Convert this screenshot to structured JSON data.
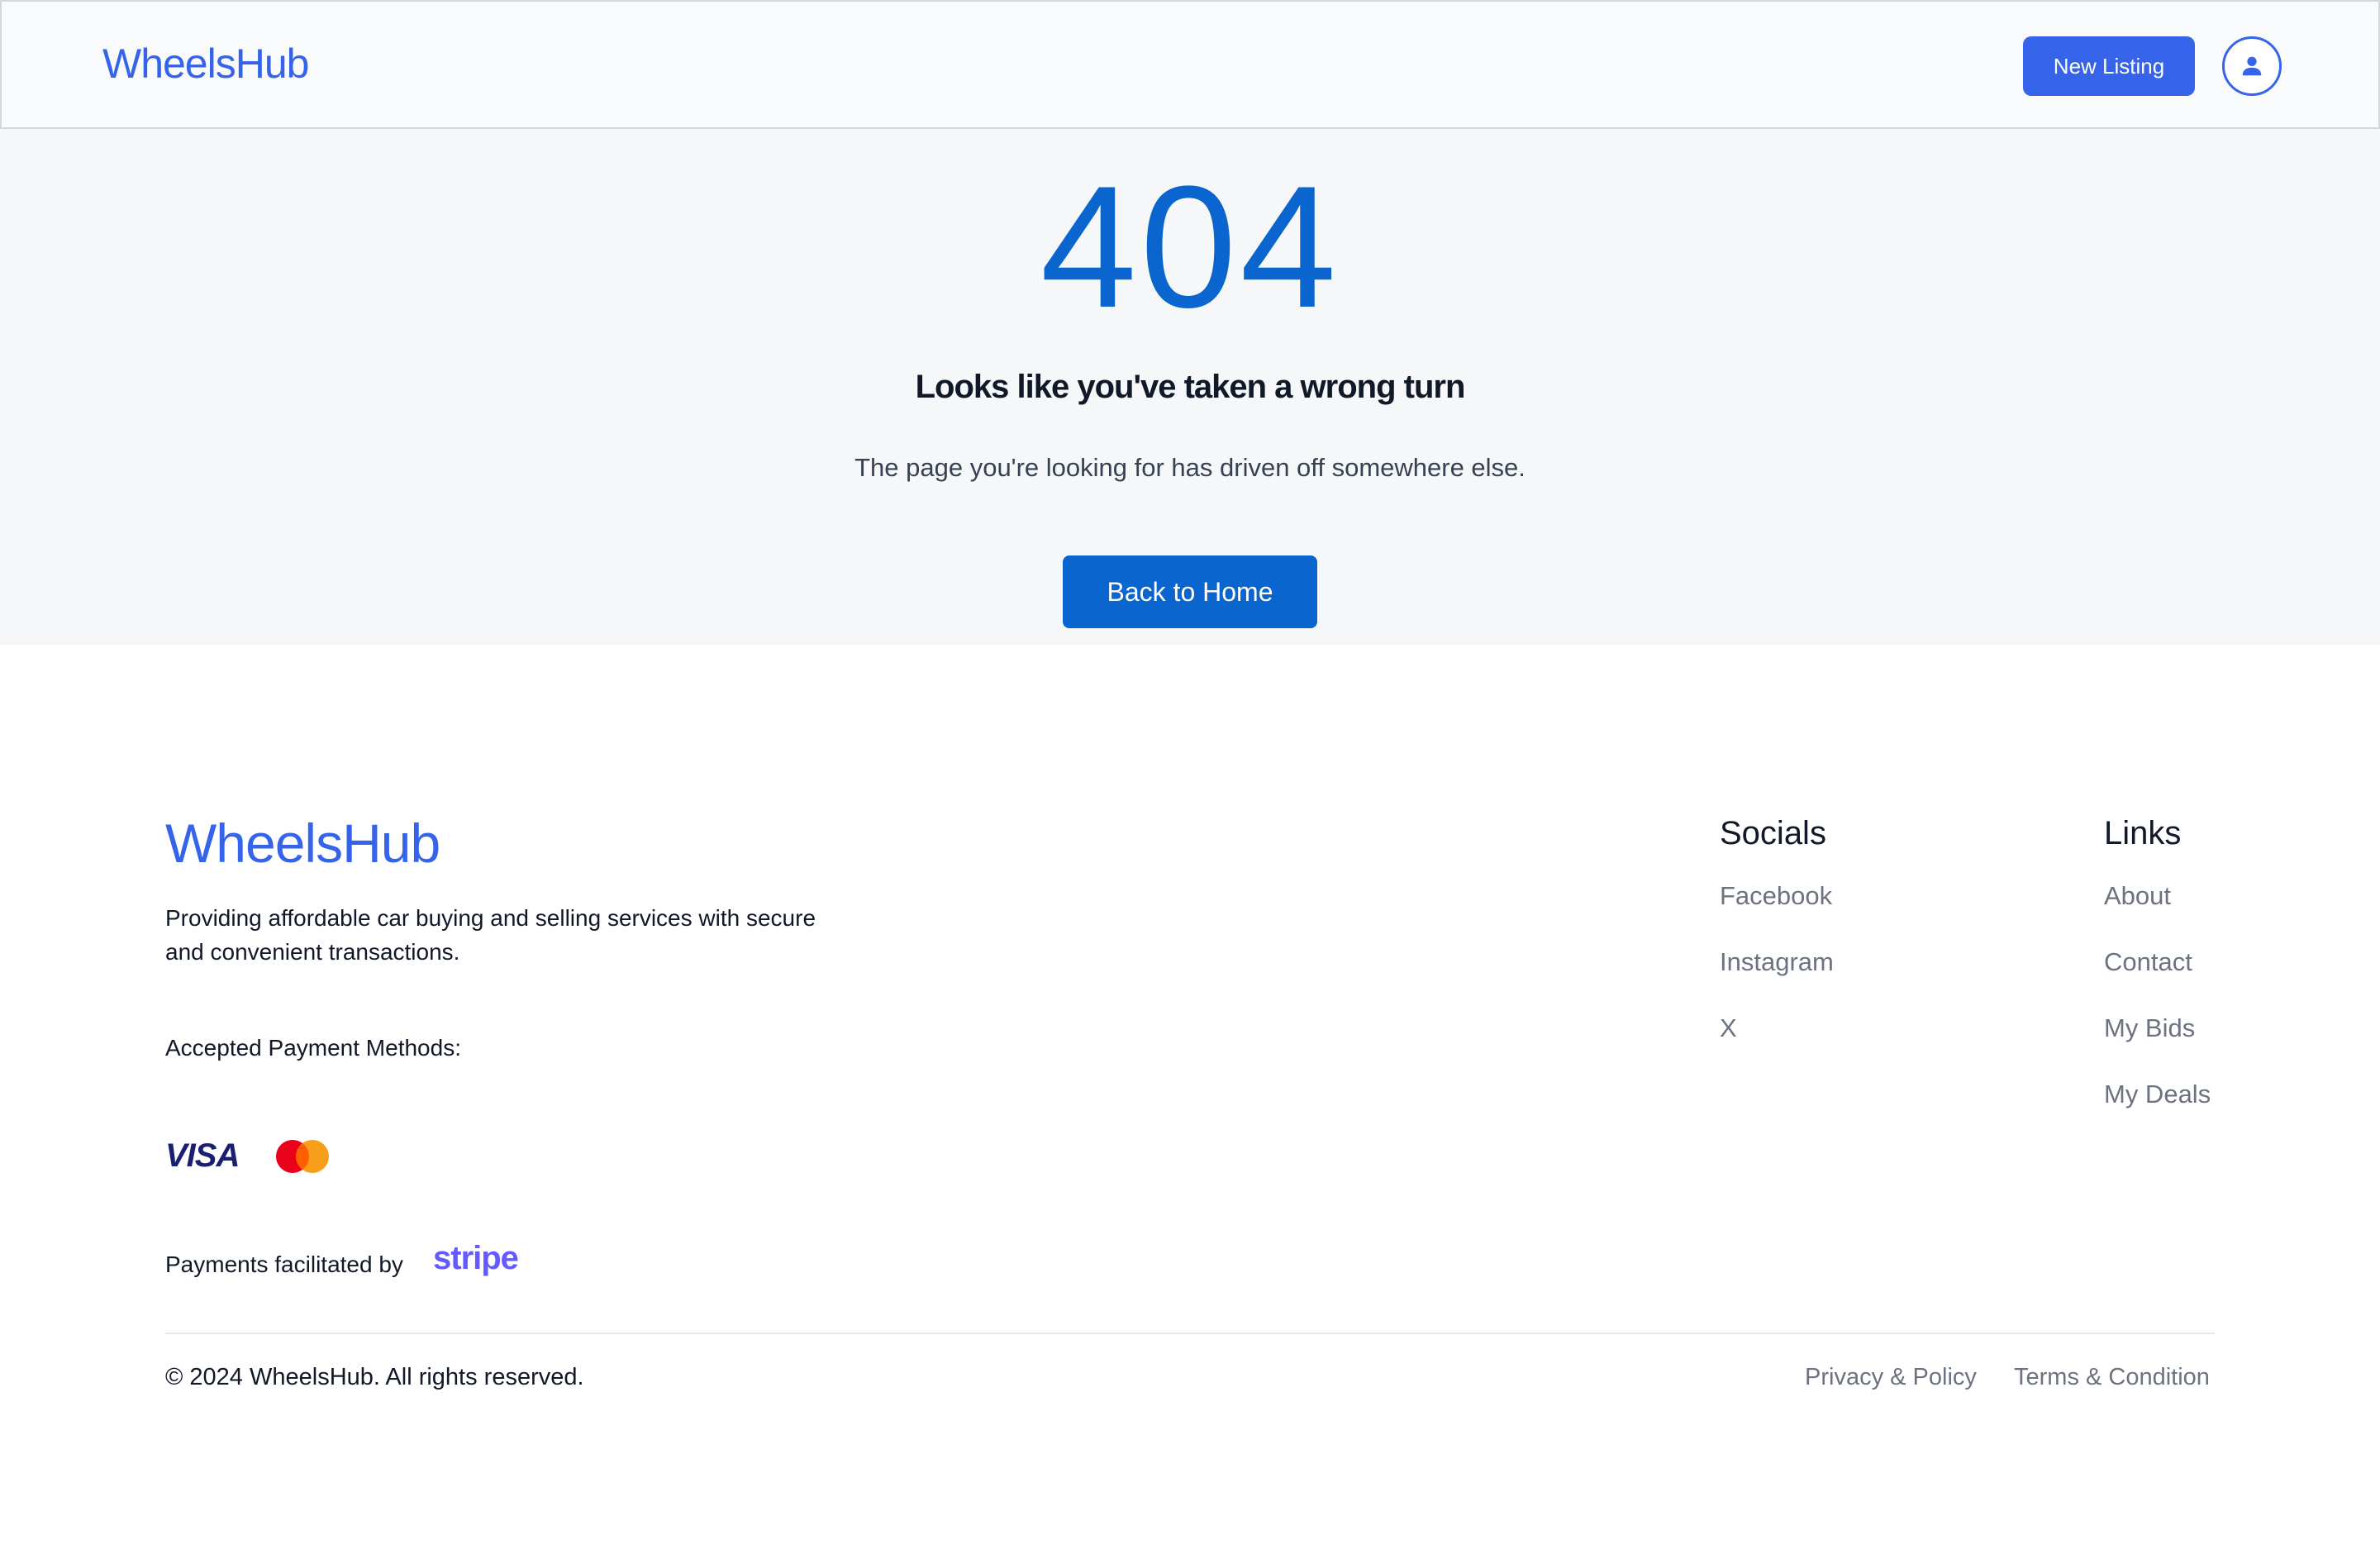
{
  "header": {
    "brand": "WheelsHub",
    "new_listing_label": "New Listing",
    "avatar_icon": "user-icon"
  },
  "hero": {
    "code": "404",
    "title": "Looks like you've taken a wrong turn",
    "subtitle": "The page you're looking for has driven off somewhere else.",
    "button_label": "Back to Home"
  },
  "footer": {
    "brand": "WheelsHub",
    "description": "Providing affordable car buying and selling services with secure and convenient transactions.",
    "payment_label": "Accepted Payment Methods:",
    "payment_methods": [
      "VISA",
      "mastercard"
    ],
    "stripe_label": "Payments facilitated by",
    "stripe_logo": "stripe",
    "socials": {
      "title": "Socials",
      "items": [
        "Facebook",
        "Instagram",
        "X"
      ]
    },
    "links": {
      "title": "Links",
      "items": [
        "About",
        "Contact",
        "My Bids",
        "My Deals"
      ]
    },
    "copyright": "© 2024 WheelsHub. All rights reserved.",
    "legal": [
      "Privacy & Policy",
      "Terms & Condition"
    ]
  },
  "colors": {
    "brand": "#3563e9",
    "primary": "#0b65cf",
    "stripe": "#635bff",
    "visa": "#1a1f71"
  }
}
